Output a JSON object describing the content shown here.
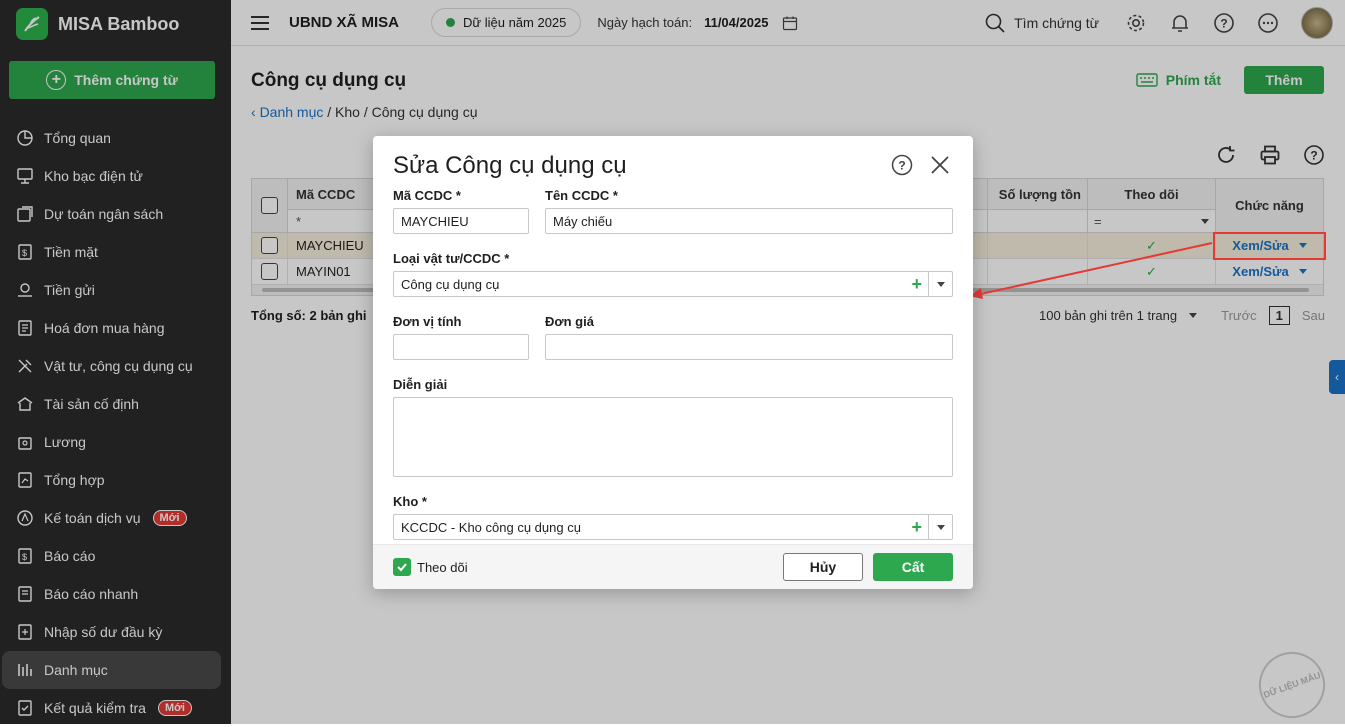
{
  "app": {
    "name": "MISA Bamboo",
    "add_voucher": "Thêm chứng từ"
  },
  "sidebar": {
    "items": [
      {
        "label": "Tổng quan",
        "icon": "pie-chart-icon"
      },
      {
        "label": "Kho bạc điện tử",
        "icon": "monitor-icon"
      },
      {
        "label": "Dự toán ngân sách",
        "icon": "budget-icon"
      },
      {
        "label": "Tiền mặt",
        "icon": "cash-icon"
      },
      {
        "label": "Tiền gửi",
        "icon": "deposit-icon"
      },
      {
        "label": "Hoá đơn mua hàng",
        "icon": "invoice-icon"
      },
      {
        "label": "Vật tư, công cụ dụng cụ",
        "icon": "tools-icon"
      },
      {
        "label": "Tài sản cố định",
        "icon": "asset-icon"
      },
      {
        "label": "Lương",
        "icon": "salary-icon"
      },
      {
        "label": "Tổng hợp",
        "icon": "summary-icon"
      },
      {
        "label": "Kế toán dịch vụ",
        "icon": "service-icon",
        "badge": "Mới"
      },
      {
        "label": "Báo cáo",
        "icon": "report-icon"
      },
      {
        "label": "Báo cáo nhanh",
        "icon": "quick-report-icon"
      },
      {
        "label": "Nhập số dư đầu kỳ",
        "icon": "opening-balance-icon"
      },
      {
        "label": "Danh mục",
        "icon": "catalog-icon",
        "active": true
      },
      {
        "label": "Kết quả kiểm tra",
        "icon": "check-result-icon",
        "badge": "Mới"
      }
    ]
  },
  "topbar": {
    "org": "UBND XÃ MISA",
    "data_year": "Dữ liệu năm 2025",
    "post_date_label": "Ngày hạch toán:",
    "post_date": "11/04/2025",
    "search_label": "Tìm chứng từ"
  },
  "page": {
    "title": "Công cụ dụng cụ",
    "hotkey_label": "Phím tắt",
    "add_label": "Thêm",
    "breadcrumb": {
      "back": "Danh mục",
      "rest": " / Kho / Công cụ dụng cụ"
    }
  },
  "grid": {
    "columns": {
      "code": "Mã CCDC",
      "qty": "Số lượng tồn",
      "track": "Theo dõi",
      "func": "Chức năng"
    },
    "filters": {
      "code_op": "*",
      "track_op": "="
    },
    "rows": [
      {
        "code": "MAYCHIEU",
        "tracked": "✓",
        "action": "Xem/Sửa",
        "selected": true
      },
      {
        "code": "MAYIN01",
        "tracked": "✓",
        "action": "Xem/Sửa",
        "selected": false
      }
    ],
    "total": "Tổng số: 2 bản ghi",
    "page_size": "100 bản ghi trên 1 trang",
    "prev": "Trước",
    "page": "1",
    "next": "Sau"
  },
  "modal": {
    "title": "Sửa Công cụ dụng cụ",
    "code_label": "Mã CCDC *",
    "code_value": "MAYCHIEU",
    "name_label": "Tên CCDC *",
    "name_value": "Máy chiếu",
    "type_label": "Loại vật tư/CCDC *",
    "type_value": "Công cụ dụng cụ",
    "unit_label": "Đơn vị tính",
    "unit_value": "",
    "price_label": "Đơn giá",
    "price_value": "",
    "desc_label": "Diễn giải",
    "stock_label": "Kho *",
    "stock_value": "KCCDC - Kho công cụ dụng cụ",
    "track_label": "Theo dõi",
    "cancel": "Hủy",
    "save": "Cất"
  },
  "watermark": "DỮ LIỆU MẪU",
  "colors": {
    "primary": "#2da84f",
    "link": "#1a73c8",
    "highlight": "#e53935",
    "sidebar": "#2b2b2b"
  }
}
